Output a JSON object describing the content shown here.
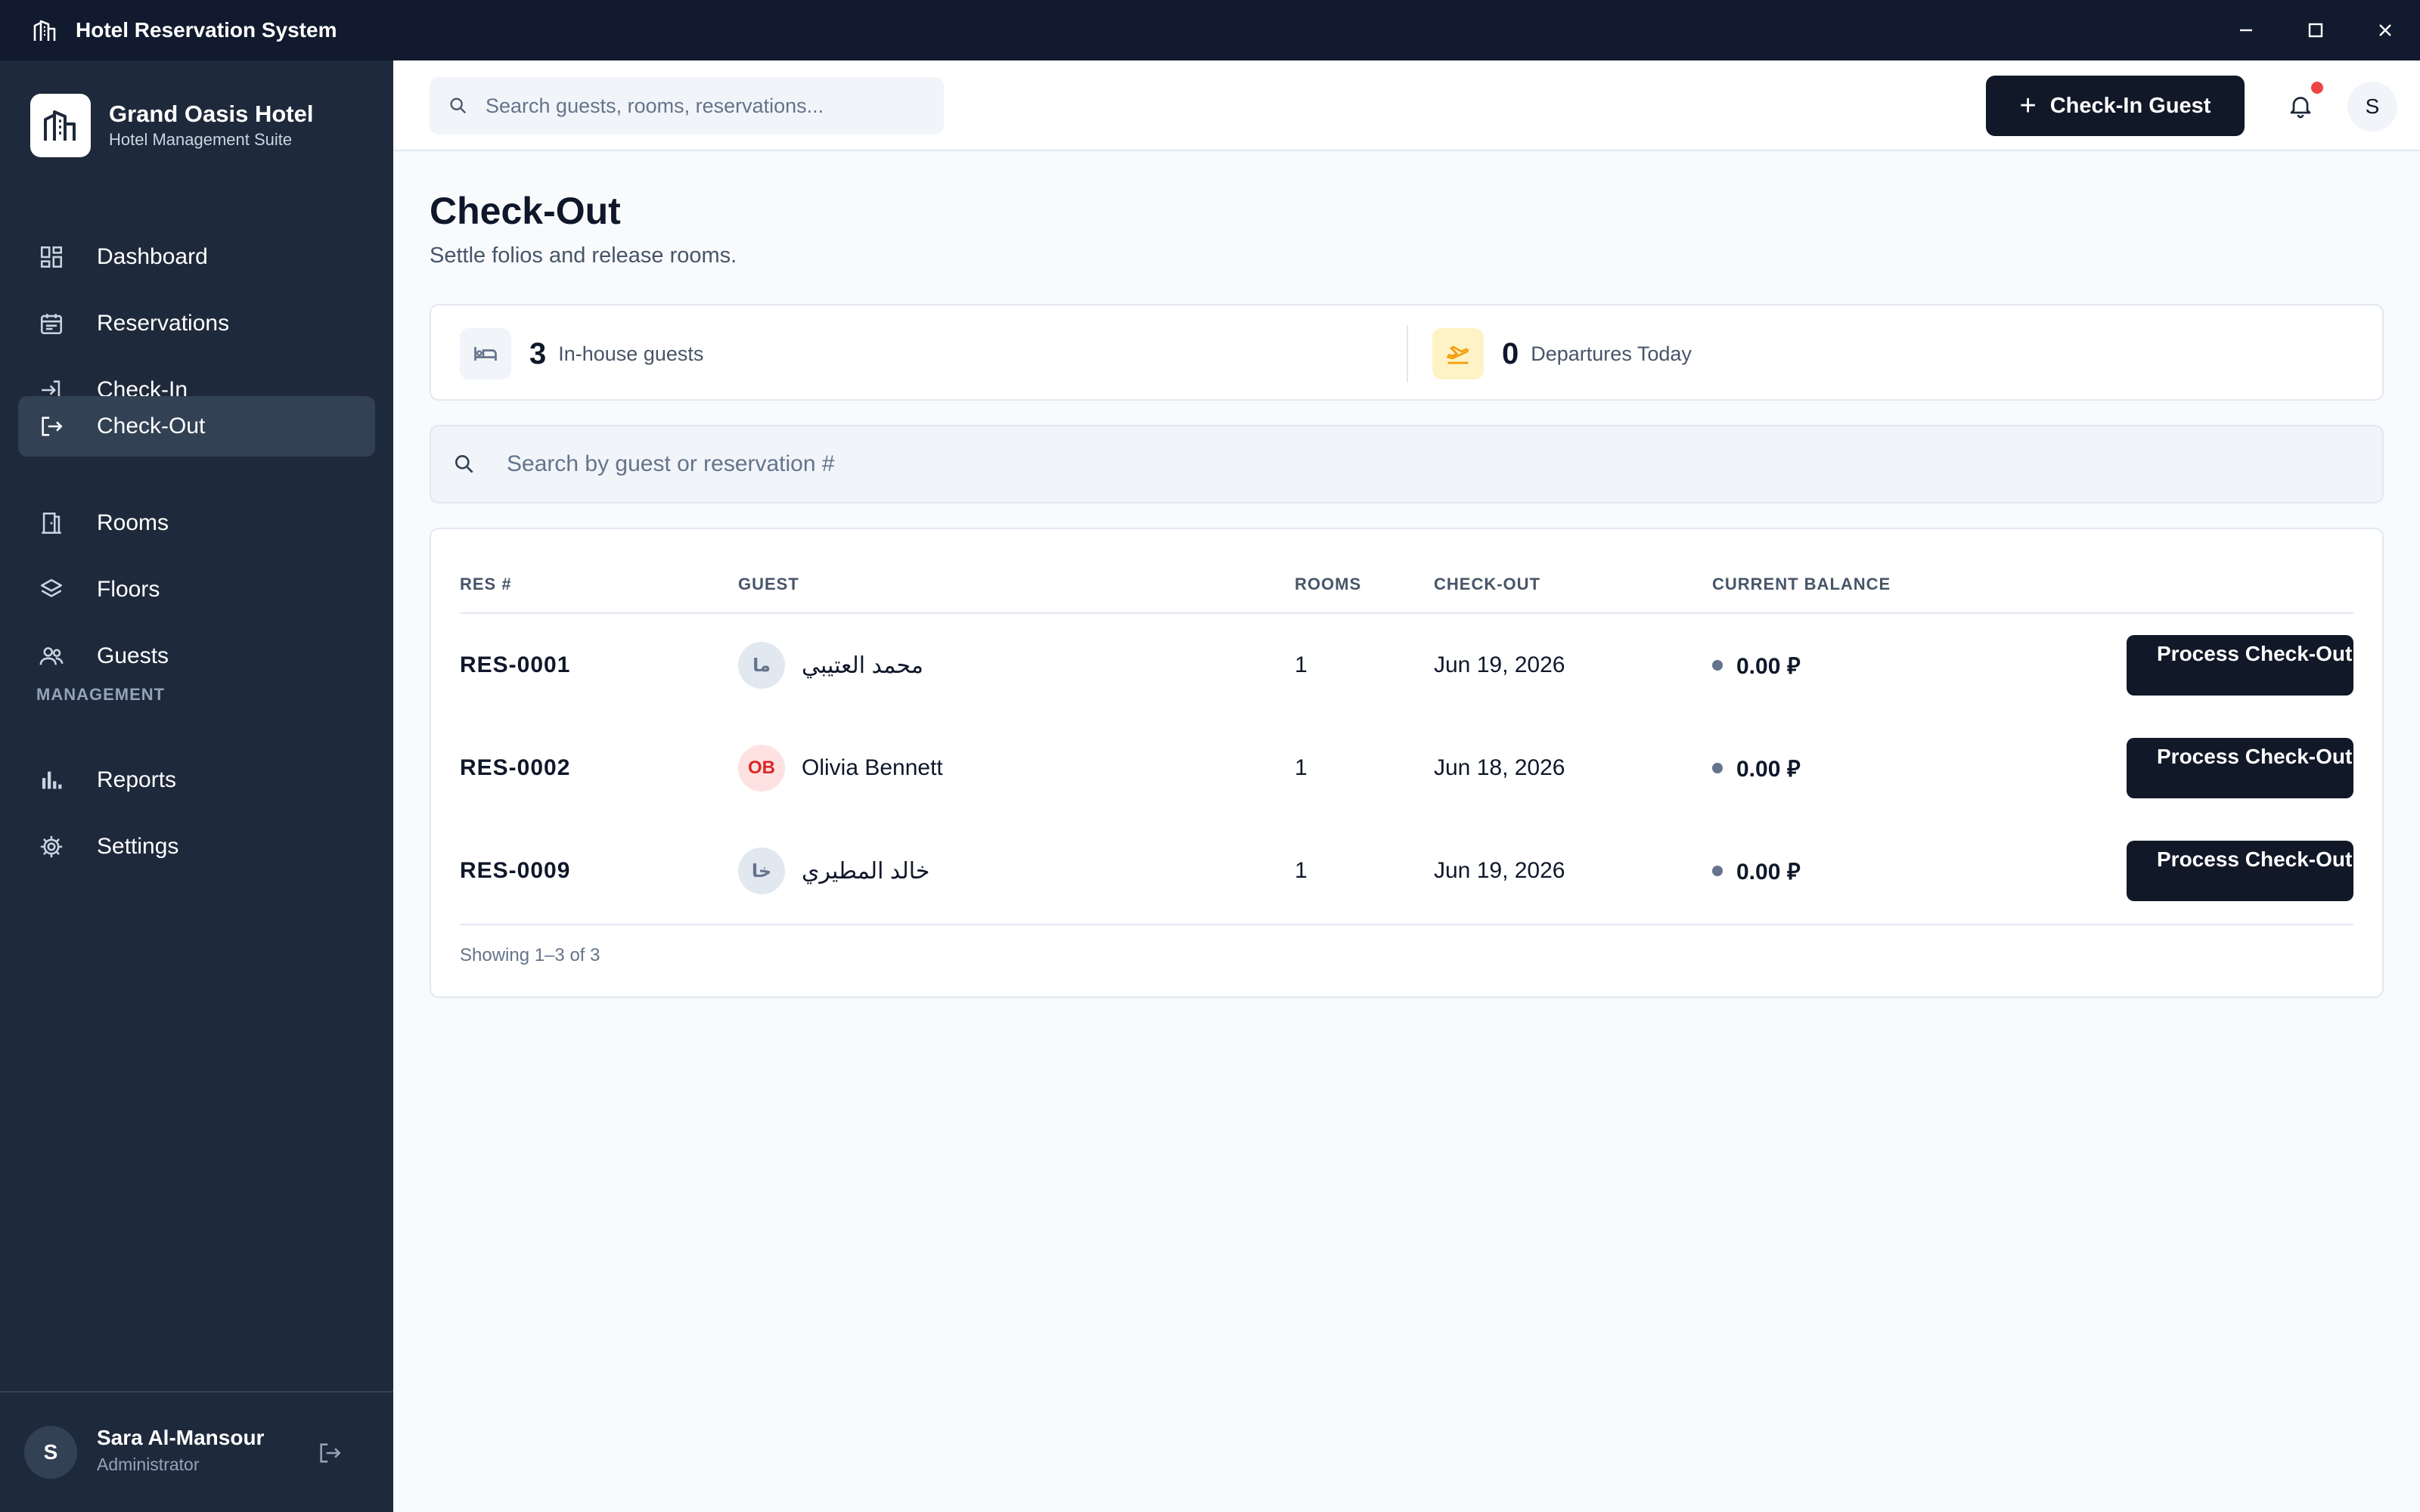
{
  "window": {
    "title": "Hotel Reservation System",
    "icons": [
      "hotel-icon",
      "minimize-icon",
      "maximize-icon",
      "close-icon"
    ]
  },
  "brand": {
    "name": "Grand Oasis Hotel",
    "subtitle": "Hotel Management Suite"
  },
  "sidebar": {
    "items": [
      {
        "label": "Dashboard",
        "icon": "dashboard-icon"
      },
      {
        "label": "Reservations",
        "icon": "calendar-icon"
      },
      {
        "label": "Check-In",
        "icon": "login-icon"
      },
      {
        "label": "Check-Out",
        "icon": "logout-icon",
        "active": true
      },
      {
        "label": "Rooms",
        "icon": "door-icon"
      },
      {
        "label": "Floors",
        "icon": "layers-icon"
      },
      {
        "label": "Guests",
        "icon": "users-icon"
      }
    ],
    "section_label": "MANAGEMENT",
    "management_items": [
      {
        "label": "Reports",
        "icon": "bar-chart-icon"
      },
      {
        "label": "Settings",
        "icon": "gear-icon"
      }
    ]
  },
  "user": {
    "initial": "S",
    "name": "Sara Al-Mansour",
    "role": "Administrator"
  },
  "topbar": {
    "search_placeholder": "Search guests, rooms, reservations...",
    "checkin_label": "Check-In Guest",
    "avatar_initial": "S"
  },
  "page": {
    "title": "Check-Out",
    "subtitle": "Settle folios and release rooms."
  },
  "stats": [
    {
      "value": "3",
      "label": "In-house guests",
      "icon": "bed-icon"
    },
    {
      "value": "0",
      "label": "Departures Today",
      "icon": "plane-departure-icon"
    }
  ],
  "search": {
    "placeholder": "Search by guest or reservation #"
  },
  "table": {
    "headers": [
      "RES #",
      "GUEST",
      "ROOMS",
      "CHECK-OUT",
      "CURRENT BALANCE"
    ],
    "rows": [
      {
        "res": "RES-0001",
        "initials": "ما",
        "guest": "محمد العتيبي",
        "rooms": "1",
        "checkout": "Jun 19, 2026",
        "balance": "0.00 ⃁",
        "action": "Process Check-Out"
      },
      {
        "res": "RES-0002",
        "initials": "OB",
        "guest": "Olivia Bennett",
        "rooms": "1",
        "checkout": "Jun 18, 2026",
        "balance": "0.00 ⃁",
        "action": "Process Check-Out"
      },
      {
        "res": "RES-0009",
        "initials": "خا",
        "guest": "خالد المطيري",
        "rooms": "1",
        "checkout": "Jun 19, 2026",
        "balance": "0.00 ⃁",
        "action": "Process Check-Out"
      }
    ],
    "footer": "Showing 1–3 of 3"
  },
  "colors": {
    "titlebar": "#111a2e",
    "sidebar": "#1e293b",
    "sidebar_active": "#334155",
    "primary_button": "#111827",
    "notification_dot": "#ef4444",
    "departures_accent": "#f59e0b",
    "guest_avatar_accent": "#dc2626"
  }
}
